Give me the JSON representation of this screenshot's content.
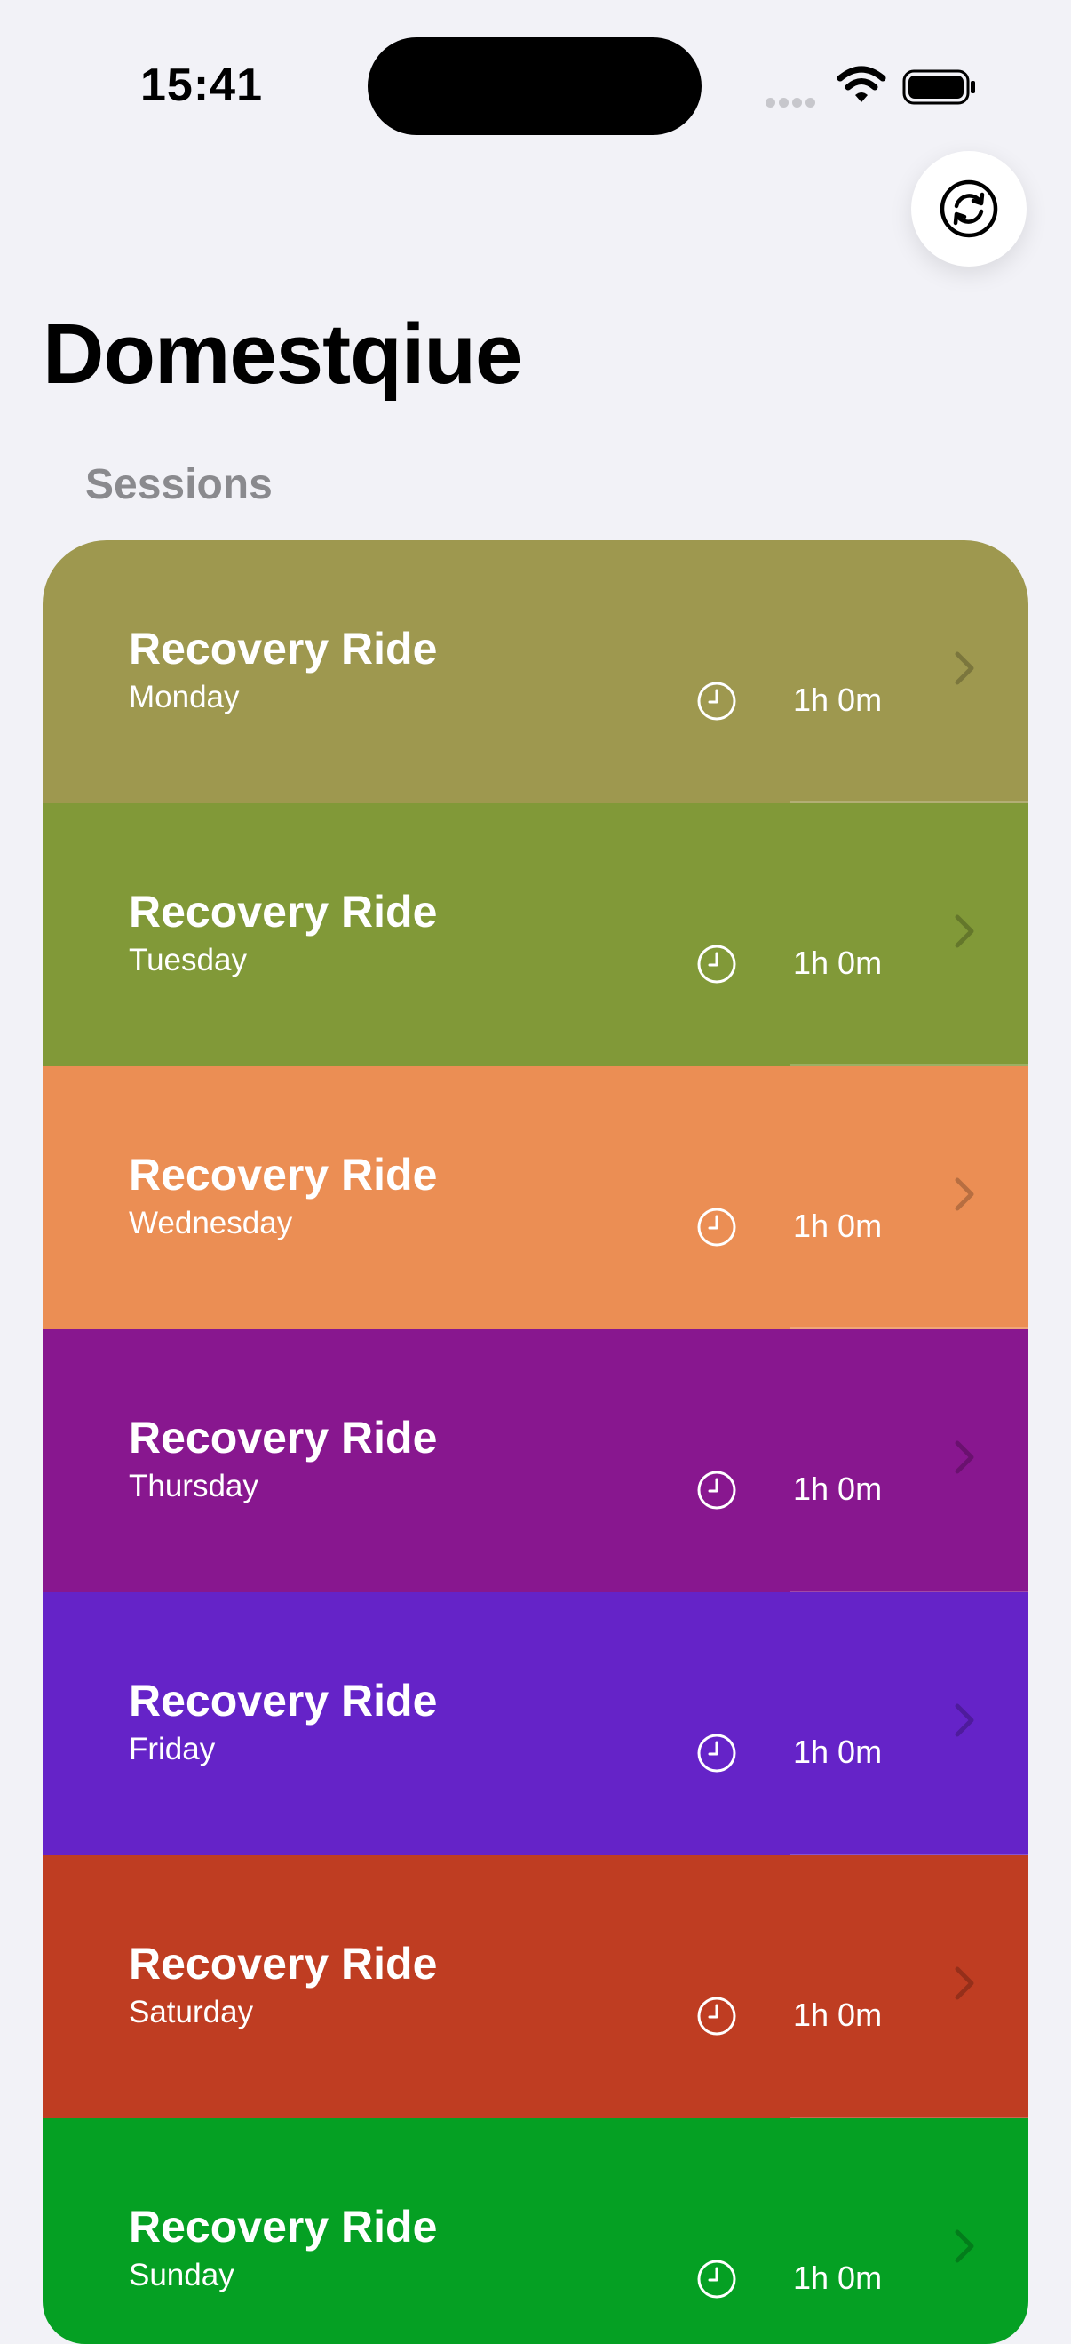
{
  "status_bar": {
    "time": "15:41"
  },
  "nav": {
    "refresh_icon": "arrow-circle-refresh-icon"
  },
  "app": {
    "title": "Domestqiue"
  },
  "section": {
    "header": "Sessions"
  },
  "sessions": [
    {
      "title": "Recovery Ride",
      "day": "Monday",
      "duration": "1h 0m",
      "color": "#9e984f"
    },
    {
      "title": "Recovery Ride",
      "day": "Tuesday",
      "duration": "1h 0m",
      "color": "#819938"
    },
    {
      "title": "Recovery Ride",
      "day": "Wednesday",
      "duration": "1h 0m",
      "color": "#eb8e54"
    },
    {
      "title": "Recovery Ride",
      "day": "Thursday",
      "duration": "1h 0m",
      "color": "#88178f"
    },
    {
      "title": "Recovery Ride",
      "day": "Friday",
      "duration": "1h 0m",
      "color": "#6523c8"
    },
    {
      "title": "Recovery Ride",
      "day": "Saturday",
      "duration": "1h 0m",
      "color": "#bf3d22"
    },
    {
      "title": "Recovery Ride",
      "day": "Sunday",
      "duration": "1h 0m",
      "color": "#05a023"
    }
  ]
}
